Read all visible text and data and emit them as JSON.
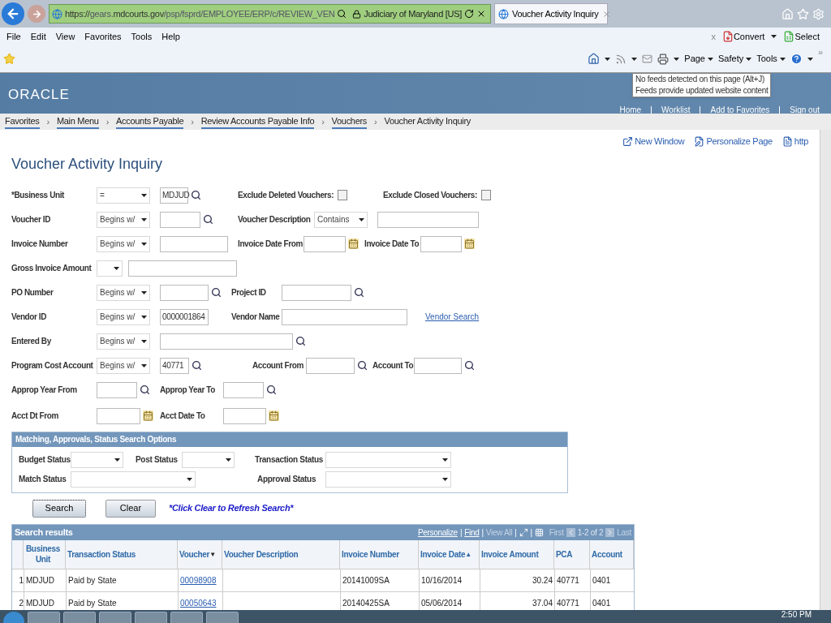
{
  "browser": {
    "url_host_prefix": "https://",
    "url_dim_1": "gears.",
    "url_host": "mdcourts.gov",
    "url_path": "/psp/fsprd/EMPLOYEE/ERP/c/REVIEW_VEN",
    "site_identity": "Judiciary of Maryland [US]",
    "tab_title": "Voucher Activity Inquiry",
    "menu": [
      "File",
      "Edit",
      "View",
      "Favorites",
      "Tools",
      "Help"
    ],
    "addon": {
      "close": "x",
      "convert": "Convert",
      "select": "Select"
    },
    "command_bar": [
      "Page",
      "Safety",
      "Tools"
    ],
    "overflow": "»",
    "tooltip": [
      "No feeds detected on this page (Alt+J)",
      "Feeds provide updated website content"
    ]
  },
  "header": {
    "logo": "ORACLE",
    "links": [
      "Home",
      "Worklist",
      "Add to Favorites",
      "Sign out"
    ]
  },
  "breadcrumb_separator": "›",
  "breadcrumbs": [
    {
      "label": "Favorites",
      "menu": true
    },
    {
      "label": "Main Menu",
      "menu": true
    },
    {
      "label": "Accounts Payable",
      "menu": true
    },
    {
      "label": "Review Accounts Payable Info",
      "menu": true
    },
    {
      "label": "Vouchers",
      "menu": true
    },
    {
      "label": "Voucher Activity Inquiry",
      "menu": false
    }
  ],
  "page_links": [
    "New Window",
    "Personalize Page",
    "http"
  ],
  "title": "Voucher Activity Inquiry",
  "form": {
    "rows": [
      [
        {
          "kind": "text",
          "label": "*Business Unit",
          "operator": "=",
          "value": "MDJUD",
          "lookup": true
        },
        {
          "kind": "checkbox",
          "label": "Exclude Deleted Vouchers:",
          "checked": false
        },
        {
          "kind": "checkbox",
          "label": "Exclude Closed Vouchers:",
          "checked": false
        }
      ],
      [
        {
          "kind": "text",
          "label": "Voucher ID",
          "operator": "Begins w/",
          "lookup": true
        },
        {
          "kind": "text",
          "label": "Voucher Description",
          "operator": "Contains"
        }
      ],
      [
        {
          "kind": "text",
          "label": "Invoice Number",
          "operator": "Begins w/"
        },
        {
          "kind": "text",
          "label": "Invoice Date From",
          "calendar": true
        },
        {
          "kind": "text",
          "label": "Invoice Date To",
          "calendar": true
        }
      ],
      [
        {
          "kind": "amount",
          "label": "Gross Invoice Amount"
        }
      ],
      [
        {
          "kind": "text",
          "label": "PO Number",
          "operator": "Begins w/",
          "lookup": true
        },
        {
          "kind": "text",
          "label": "Project ID",
          "lookup": true
        }
      ],
      [
        {
          "kind": "text",
          "label": "Vendor ID",
          "operator": "Begins w/",
          "value": "0000001864"
        },
        {
          "kind": "text",
          "label": "Vendor Name"
        },
        {
          "kind": "link",
          "label": "Vendor Search"
        }
      ],
      [
        {
          "kind": "text",
          "label": "Entered By",
          "operator": "Begins w/",
          "lookup": true
        }
      ],
      [
        {
          "kind": "text",
          "label": "Program Cost Account",
          "operator": "Begins w/",
          "value": "40771",
          "lookup": true
        },
        {
          "kind": "text",
          "label": "Account From",
          "lookup": true
        },
        {
          "kind": "text",
          "label": "Account To",
          "lookup": true
        }
      ],
      [
        {
          "kind": "text",
          "label": "Approp Year From",
          "lookup": true
        },
        {
          "kind": "text",
          "label": "Approp Year To",
          "lookup": true
        }
      ],
      [
        {
          "kind": "text",
          "label": "Acct Dt From",
          "calendar": true
        },
        {
          "kind": "text",
          "label": "Acct Date To",
          "calendar": true
        }
      ]
    ]
  },
  "status_panel": {
    "title": "Matching, Approvals, Status Search Options",
    "fields": [
      "Budget Status",
      "Post Status",
      "Transaction Status",
      "Match Status",
      "Approval Status"
    ]
  },
  "actions": {
    "search": "Search",
    "clear": "Clear",
    "note": "*Click Clear to Refresh Search*"
  },
  "results": {
    "title": "Search results",
    "nav": {
      "separator": "|",
      "personalize": "Personalize",
      "find": "Find",
      "view_all": "View All",
      "first": "First",
      "count": "1-2 of 2",
      "last": "Last"
    },
    "columns": [
      {
        "label": "Business Unit"
      },
      {
        "label": "Transaction Status"
      },
      {
        "label": "Voucher",
        "sort": "▼"
      },
      {
        "label": "Voucher Description"
      },
      {
        "label": "Invoice Number"
      },
      {
        "label": "Invoice Date",
        "sort": "▲"
      },
      {
        "label": "Invoice Amount"
      },
      {
        "label": "PCA"
      },
      {
        "label": "Account"
      }
    ],
    "rows": [
      {
        "n": "1",
        "cells": [
          "MDJUD",
          "Paid by State",
          "00098908",
          null,
          "20141009SA",
          "10/16/2014",
          "30.24",
          "40771",
          "0401"
        ]
      },
      {
        "n": "2",
        "cells": [
          "MDJUD",
          "Paid by State",
          "00050643",
          null,
          "20140425SA",
          "05/06/2014",
          "37.04",
          "40771",
          "0401"
        ]
      }
    ]
  },
  "taskbar": {
    "clock": "2:50 PM"
  }
}
